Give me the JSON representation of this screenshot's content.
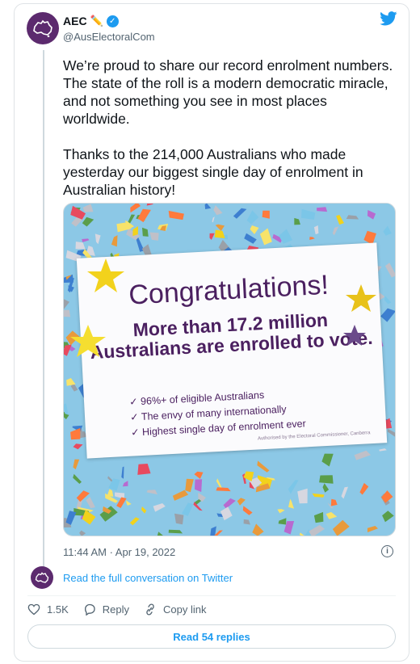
{
  "author": {
    "name": "AEC",
    "handle": "@AusElectoralCom",
    "emoji": "✏️"
  },
  "tweet": {
    "text": "We’re proud to share our record enrolment numbers. The state of the roll is a modern democratic miracle, and not something you see in most places worldwide.\n\nThanks to the 214,000 Australians who made yesterday our biggest single day of enrolment in Australian history!",
    "timestamp": "11:44 AM · Apr 19, 2022"
  },
  "image": {
    "heading": "Congratulations!",
    "headline": "More than 17.2 million Australians are enrolled to vote.",
    "bullets": [
      "96%+ of eligible Australians",
      "The envy of many internationally",
      "Highest single day of enrolment ever"
    ],
    "authorised": "Authorised by the Electoral Commissioner, Canberra"
  },
  "conversation_link": "Read the full conversation on Twitter",
  "actions": {
    "likes": "1.5K",
    "reply": "Reply",
    "copy_link": "Copy link"
  },
  "read_replies": "Read 54 replies",
  "colors": {
    "brand_purple": "#5c2a6e",
    "twitter_blue": "#1d9bf0"
  }
}
